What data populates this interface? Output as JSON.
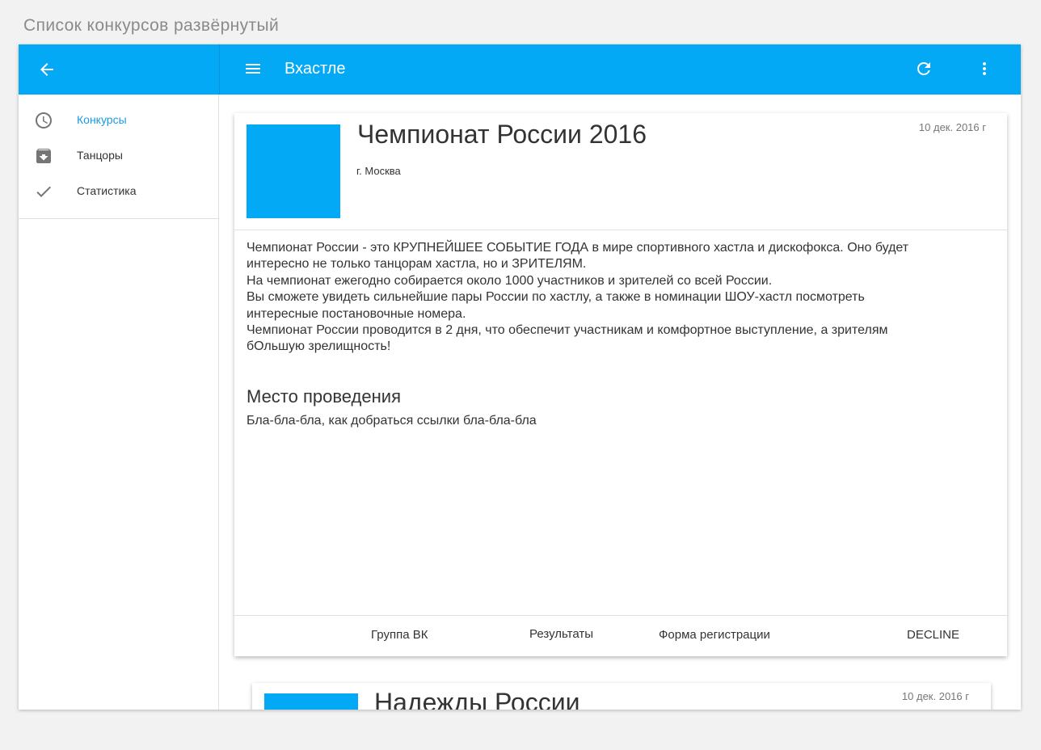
{
  "page": {
    "caption": "Список конкурсов развёрнутый"
  },
  "colors": {
    "primary": "#03a9f4",
    "active_nav": "#1a9ae0"
  },
  "appbar": {
    "title": "Вхастле",
    "icons": {
      "back": "arrow-back-icon",
      "menu": "hamburger-menu-icon",
      "refresh": "refresh-icon",
      "more": "more-vert-icon"
    }
  },
  "sidebar": {
    "items": [
      {
        "label": "Конкурсы",
        "icon": "clock-icon",
        "active": true
      },
      {
        "label": "Танцоры",
        "icon": "archive-icon",
        "active": false
      },
      {
        "label": "Статистика",
        "icon": "check-icon",
        "active": false
      }
    ]
  },
  "cards": [
    {
      "title": "Чемпионат России 2016",
      "date": "10 дек. 2016 г",
      "city": "г. Москва",
      "description": [
        "Чемпионат России - это КРУПНЕЙШЕЕ СОБЫТИЕ ГОДА в мире спортивного хастла и дискофокса. Оно будет",
        "интересно не только танцорам хастла, но и ЗРИТЕЛЯМ.",
        "На чемпионат ежегодно собирается около 1000 участников и зрителей со всей России.",
        "Вы сможете увидеть сильнейшие пары России по хастлу, а также в номинации ШОУ-хастл посмотреть",
        "интересные постановочные номера.",
        "Чемпионат России проводится в 2 дня, что обеспечит участникам и комфортное выступление, а зрителям",
        "бОльшую зрелищность!"
      ],
      "venue_title": "Место проведения",
      "venue_text": "Бла-бла-бла, как добраться ссылки бла-бла-бла",
      "actions": [
        "Группа ВК",
        "Результаты",
        "Форма регистрации",
        "DECLINE"
      ]
    },
    {
      "title": "Надежды России",
      "date": "10 дек. 2016 г"
    }
  ]
}
